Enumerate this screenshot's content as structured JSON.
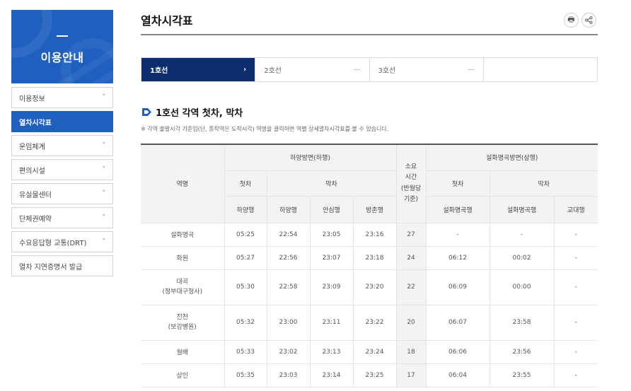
{
  "sidebar": {
    "title": "이용안내",
    "items": [
      {
        "label": "이용정보",
        "chevron": "˅"
      },
      {
        "label": "열차시각표",
        "chevron": ""
      },
      {
        "label": "운임체계",
        "chevron": "˅"
      },
      {
        "label": "편의시설",
        "chevron": "˅"
      },
      {
        "label": "유실물센터",
        "chevron": "˅"
      },
      {
        "label": "단체권예약",
        "chevron": "˅"
      },
      {
        "label": "수요응답형 교통(DRT)",
        "chevron": "˅"
      },
      {
        "label": "열차 지연증명서 발급",
        "chevron": ""
      }
    ]
  },
  "page": {
    "title": "열차시각표",
    "print_glyph": "🖶",
    "share_glyph": "<"
  },
  "tabs": [
    {
      "label": "1호선",
      "mark": "›"
    },
    {
      "label": "2호선",
      "mark": "—"
    },
    {
      "label": "3호선",
      "mark": "—"
    },
    {
      "label": "",
      "mark": ""
    }
  ],
  "section": {
    "title": "1호선 각역 첫차, 막차",
    "note": "※ 각역 출발시각 기준임(단, 종착역은 도착시각) 역명을 클릭하면 역별 상세열차시각표를 볼 수 있습니다."
  },
  "table": {
    "headers": {
      "station": "역명",
      "down_group": "하양방면(하행)",
      "first": "첫차",
      "last": "막차",
      "duration": "소요\n시간\n(반월당\n기준)",
      "up_group": "설화명곡방면(상행)",
      "first2": "첫차",
      "last2": "막차",
      "sub": [
        "하양행",
        "하양행",
        "안심행",
        "방촌행",
        "설화명곡행",
        "설화명곡행",
        "교대행"
      ]
    },
    "rows": [
      {
        "name": "설화명곡",
        "sub": "",
        "cells": [
          "05:25",
          "22:54",
          "23:05",
          "23:16",
          "27",
          "-",
          "-",
          "-"
        ]
      },
      {
        "name": "화원",
        "sub": "",
        "cells": [
          "05:27",
          "22:56",
          "23:07",
          "23:18",
          "24",
          "06:12",
          "00:02",
          "-"
        ]
      },
      {
        "name": "대곡",
        "sub": "(정부대구청사)",
        "cells": [
          "05:30",
          "22:58",
          "23:09",
          "23:20",
          "22",
          "06:09",
          "00:00",
          "-"
        ]
      },
      {
        "name": "진천",
        "sub": "(보강병원)",
        "cells": [
          "05:32",
          "23:00",
          "23:11",
          "23:22",
          "20",
          "06:07",
          "23:58",
          "-"
        ]
      },
      {
        "name": "월배",
        "sub": "",
        "cells": [
          "05:33",
          "23:02",
          "23:13",
          "23:24",
          "18",
          "06:06",
          "23:56",
          "-"
        ]
      },
      {
        "name": "상인",
        "sub": "",
        "cells": [
          "05:35",
          "23:03",
          "23:14",
          "23:25",
          "17",
          "06:04",
          "23:55",
          "-"
        ]
      }
    ]
  },
  "colors": {
    "primary": "#1e5fbf",
    "tab_active": "#0e2d6e"
  }
}
